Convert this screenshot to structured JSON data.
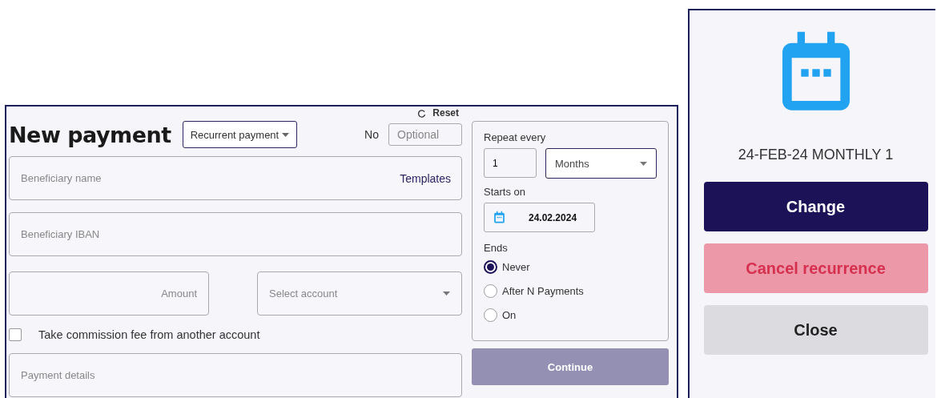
{
  "reset": {
    "label": "Reset"
  },
  "title": "New payment",
  "payment_type": {
    "value": "Recurrent payment"
  },
  "number": {
    "label": "No",
    "placeholder": "Optional"
  },
  "beneficiary_name": {
    "placeholder": "Beneficiary name",
    "link": "Templates"
  },
  "beneficiary_iban": {
    "placeholder": "Beneficiary IBAN"
  },
  "amount": {
    "placeholder": "Amount"
  },
  "account": {
    "placeholder": "Select account"
  },
  "commission": {
    "label": "Take commission fee from another account",
    "checked": false
  },
  "payment_details": {
    "placeholder": "Payment details"
  },
  "schedule": {
    "repeat_label": "Repeat every",
    "interval": "1",
    "unit": "Months",
    "starts_label": "Starts on",
    "start_date": "24.02.2024",
    "ends_label": "Ends",
    "ends_options": [
      {
        "label": "Never",
        "selected": true
      },
      {
        "label": "After N Payments",
        "selected": false
      },
      {
        "label": "On",
        "selected": false
      }
    ]
  },
  "continue_button": {
    "label": "Continue",
    "disabled": true
  },
  "summary": {
    "text": "24-FEB-24 MONTHLY 1",
    "buttons": [
      {
        "label": "Change",
        "kind": "primary"
      },
      {
        "label": "Cancel recurrence",
        "kind": "danger"
      },
      {
        "label": "Close",
        "kind": "secondary"
      }
    ]
  }
}
